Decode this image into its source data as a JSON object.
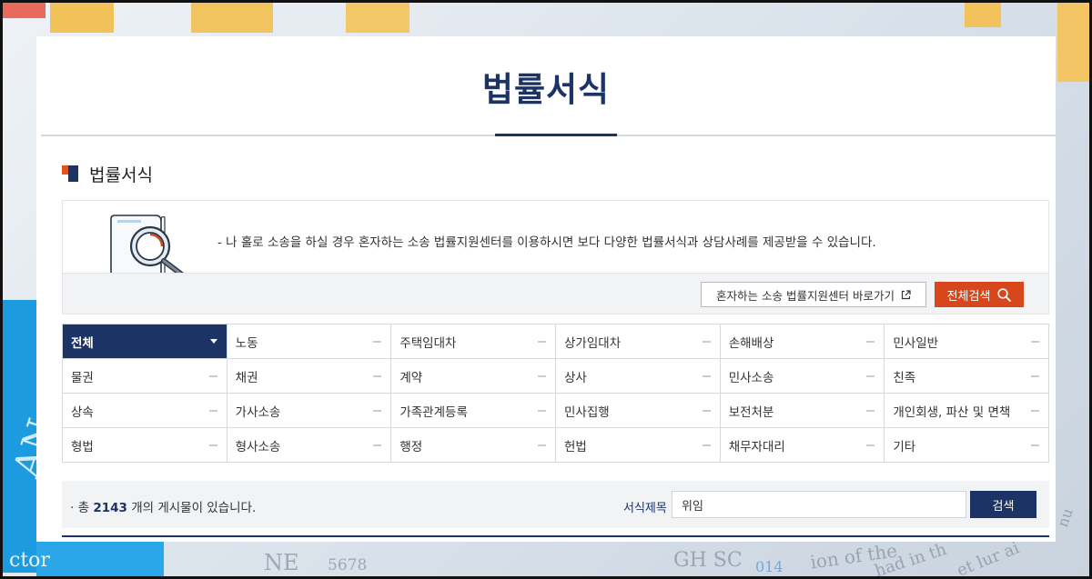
{
  "page_title": "법률서식",
  "section_title": "법률서식",
  "info": {
    "text": "- 나 홀로 소송을 하실 경우 혼자하는 소송 법률지원센터를 이용하시면 보다 다양한 법률서식과 상담사례를 제공받을 수 있습니다.",
    "link_button": "혼자하는 소송 법률지원센터 바로가기",
    "search_all_button": "전체검색"
  },
  "categories": [
    [
      "전체",
      "노동",
      "주택임대차",
      "상가임대차",
      "손해배상",
      "민사일반"
    ],
    [
      "물권",
      "채권",
      "계약",
      "상사",
      "민사소송",
      "친족"
    ],
    [
      "상속",
      "가사소송",
      "가족관계등록",
      "민사집행",
      "보전처분",
      "개인회생, 파산 및 면책"
    ],
    [
      "형법",
      "형사소송",
      "행정",
      "헌법",
      "채무자대리",
      "기타"
    ]
  ],
  "active_category": "전체",
  "result": {
    "prefix": "총",
    "count": "2143",
    "suffix": "개의 게시물이 있습니다."
  },
  "search": {
    "label": "서식제목",
    "value": "위임",
    "button": "검색"
  },
  "colors": {
    "brand_navy": "#1c3366",
    "accent_orange": "#d8461b"
  },
  "icons": {
    "section": "square-blocks-icon",
    "illustration": "document-magnifier-icon",
    "external_link": "external-link-icon",
    "search": "search-icon"
  }
}
